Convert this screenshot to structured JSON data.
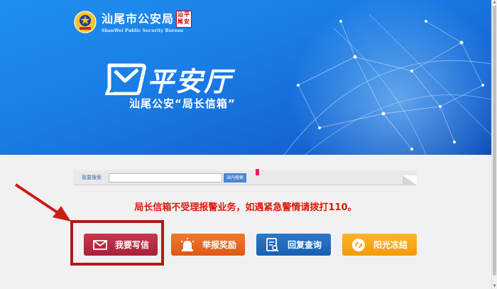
{
  "header": {
    "agency_name": "汕尾市公安局",
    "agency_name_en": "ShanWei Public Security Bureau",
    "seal_text": "汕平尾安"
  },
  "hero": {
    "title": "平安厅",
    "subtitle": "汕尾公安“局长信箱”"
  },
  "search": {
    "label": "我要搜索",
    "input_value": "",
    "button_label": "站内搜索"
  },
  "notice": "局长信箱不受理报警业务，如遇紧急警情请拨打110。",
  "actions": [
    {
      "label": "我要写信",
      "icon": "envelope-icon",
      "color": "#b52a40"
    },
    {
      "label": "举报奖励",
      "icon": "alarm-light-icon",
      "color": "#e8661f"
    },
    {
      "label": "回复查询",
      "icon": "document-search-icon",
      "color": "#226bbf"
    },
    {
      "label": "阳光冻结",
      "icon": "sun-link-icon",
      "color": "#f7a51a"
    }
  ],
  "colors": {
    "banner": "#1a7ee6",
    "notice": "#e0190b",
    "highlight": "#b01b14"
  }
}
